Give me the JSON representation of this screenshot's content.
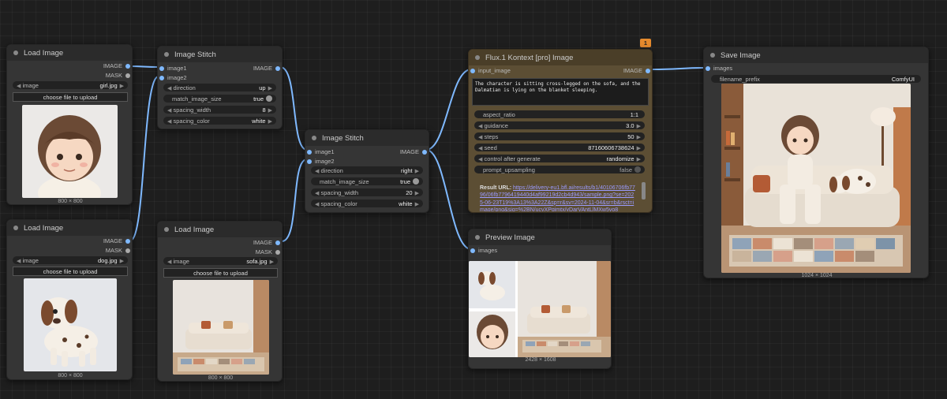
{
  "colors": {
    "canvas": "#1e1e1e",
    "node": "#353535",
    "wire": "#7fb9ff",
    "kontext_title": "#5c4e34",
    "badge": "#e58a2d"
  },
  "nodes": {
    "load1": {
      "title": "Load Image",
      "out_image": "IMAGE",
      "out_mask": "MASK",
      "image_label": "image",
      "image_value": "girl.jpg",
      "upload": "choose file to upload",
      "dims": "800 × 800"
    },
    "load2": {
      "title": "Load Image",
      "out_image": "IMAGE",
      "out_mask": "MASK",
      "image_label": "image",
      "image_value": "dog.jpg",
      "upload": "choose file to upload",
      "dims": "800 × 800"
    },
    "load3": {
      "title": "Load Image",
      "out_image": "IMAGE",
      "out_mask": "MASK",
      "image_label": "image",
      "image_value": "sofa.jpg",
      "upload": "choose file to upload",
      "dims": "800 × 800"
    },
    "stitch1": {
      "title": "Image Stitch",
      "in1": "image1",
      "in2": "image2",
      "out": "IMAGE",
      "widgets": [
        {
          "label": "direction",
          "value": "up"
        },
        {
          "label": "match_image_size",
          "value": "true"
        },
        {
          "label": "spacing_width",
          "value": "8"
        },
        {
          "label": "spacing_color",
          "value": "white"
        }
      ]
    },
    "stitch2": {
      "title": "Image Stitch",
      "in1": "image1",
      "in2": "image2",
      "out": "IMAGE",
      "widgets": [
        {
          "label": "direction",
          "value": "right"
        },
        {
          "label": "match_image_size",
          "value": "true"
        },
        {
          "label": "spacing_width",
          "value": "20"
        },
        {
          "label": "spacing_color",
          "value": "white"
        }
      ]
    },
    "kontext": {
      "title": "Flux.1 Kontext [pro] Image",
      "badge": "1",
      "in": "input_image",
      "out": "IMAGE",
      "prompt": "The character is sitting cross-legged on the sofa, and the Dalmatian is lying on the blanket sleeping.",
      "widgets": [
        {
          "label": "aspect_ratio",
          "value": "1:1"
        },
        {
          "label": "guidance",
          "value": "3.0"
        },
        {
          "label": "steps",
          "value": "50"
        },
        {
          "label": "seed",
          "value": "87160606738624"
        },
        {
          "label": "control after generate",
          "value": "randomize"
        },
        {
          "label": "prompt_upsampling",
          "value": "false"
        }
      ],
      "result_label": "Result URL:",
      "result_url": "https://delivery-eu1.bfl.ai/results/b1/40106706fb7796/06fb7796419440d4af99219d2cb4d943/sample.png?se=2025-06-23T19%3A13%3A22Z&sp=r&sv=2024-11-04&sr=b&rsct=image/png&sig=%2BN/ucvXPqjmtx/yDarVAntLlMXw5vo8"
    },
    "preview": {
      "title": "Preview Image",
      "in": "images",
      "dims": "2428 × 1608"
    },
    "save": {
      "title": "Save Image",
      "in": "images",
      "prefix_label": "filename_prefix",
      "prefix_value": "ComfyUI",
      "dims": "1024 × 1024"
    }
  }
}
